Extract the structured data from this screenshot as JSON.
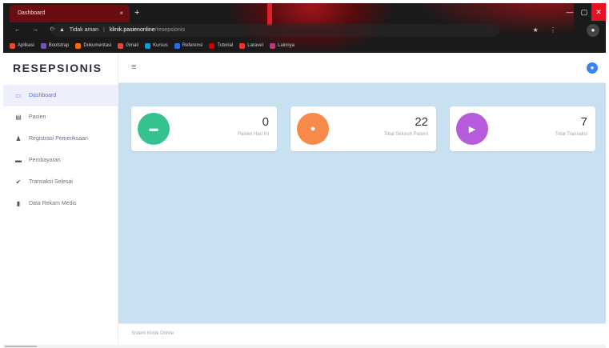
{
  "browser": {
    "tab_title": "Dashboard",
    "tab_close": "×",
    "new_tab": "+",
    "nav": "← → ⟳",
    "security_warning": "▲",
    "security_text": "Tidak aman",
    "host": "klinik.pasienonline",
    "path": "/resepsionis",
    "extensions": "★ ⋮",
    "profile": "●",
    "win_min": "—",
    "win_max": "▢",
    "win_close": "✕",
    "bookmarks": [
      {
        "label": "Aplikasi",
        "color": "#e34c26"
      },
      {
        "label": "Bootstrap",
        "color": "#7952b3"
      },
      {
        "label": "Dokumentasi",
        "color": "#ff6a00"
      },
      {
        "label": "Gmail",
        "color": "#ea4335"
      },
      {
        "label": "Kursus",
        "color": "#00a1e0"
      },
      {
        "label": "Referensi",
        "color": "#2a6ae9"
      },
      {
        "label": "Tutorial",
        "color": "#cc0000"
      },
      {
        "label": "Laravel",
        "color": "#ff2d20"
      },
      {
        "label": "Lainnya",
        "color": "#c13584"
      }
    ]
  },
  "app": {
    "brand": "RESEPSIONIS",
    "hamburger": "≡",
    "user_icon": "●",
    "menu": [
      {
        "label": "Dashboard",
        "icon": "▭",
        "icon_name": "monitor-icon",
        "active": true
      },
      {
        "label": "Pasien",
        "icon": "▤",
        "icon_name": "list-icon",
        "active": false
      },
      {
        "label": "Registrasi Pemeriksaan",
        "icon": "♟",
        "icon_name": "user-icon",
        "active": false
      },
      {
        "label": "Pembayaran",
        "icon": "▬",
        "icon_name": "money-icon",
        "active": false
      },
      {
        "label": "Transaksi Selesai",
        "icon": "✔",
        "icon_name": "check-icon",
        "active": false
      },
      {
        "label": "Data Rekam Medis",
        "icon": "▮",
        "icon_name": "file-icon",
        "active": false
      }
    ],
    "cards": [
      {
        "value": "0",
        "label": "Pasien Hari Ini",
        "color": "#34c38f",
        "icon": "▬"
      },
      {
        "value": "22",
        "label": "Total Seluruh Pasien",
        "color": "#f7894a",
        "icon": "●"
      },
      {
        "value": "7",
        "label": "Total Transaksi",
        "color": "#b65bdc",
        "icon": "▶"
      }
    ],
    "footer": "Sistem Klinik Online"
  }
}
